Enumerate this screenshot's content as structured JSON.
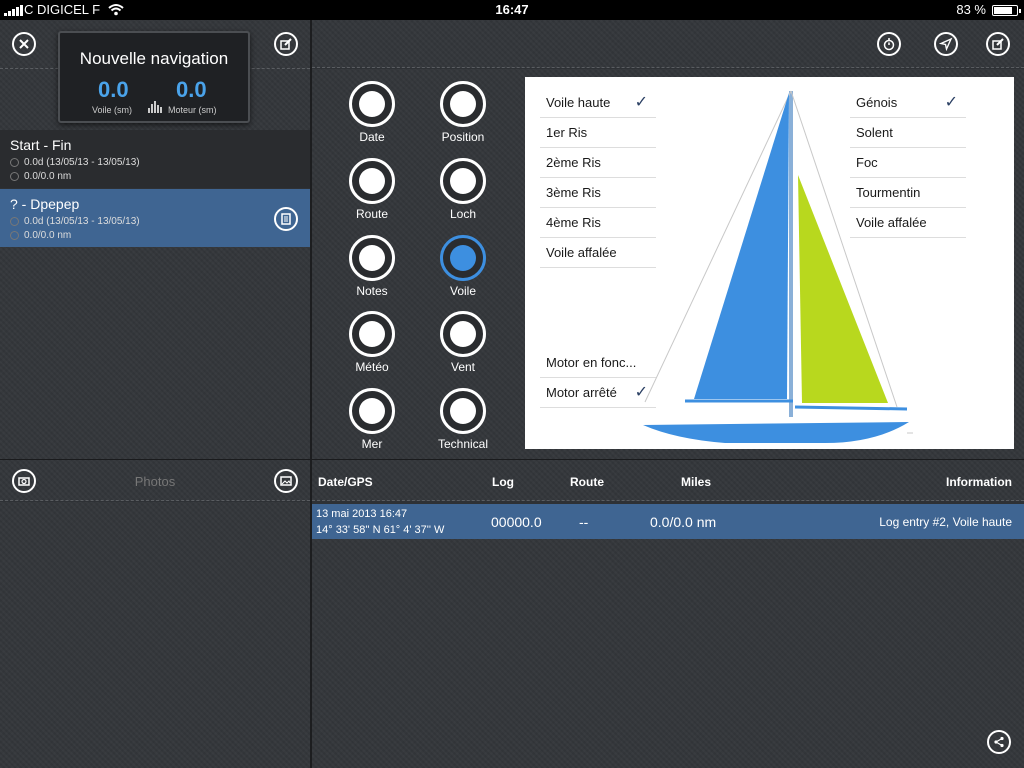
{
  "status": {
    "carrier": "C DIGICEL F",
    "time": "16:47",
    "battery": "83 %"
  },
  "nav": {
    "title": "Nouvelle navigation",
    "sail_value": "0.0",
    "motor_value": "0.0",
    "sail_label": "Voile (sm)",
    "motor_label": "Moteur (sm)"
  },
  "trips": [
    {
      "title": "Start - Fin",
      "line1": "0.0d (13/05/13 - 13/05/13)",
      "line2": "0.0/0.0 nm"
    },
    {
      "title": "? - Dpepep",
      "line1": "0.0d (13/05/13 - 13/05/13)",
      "line2": "0.0/0.0 nm"
    }
  ],
  "photos_label": "Photos",
  "categories": [
    {
      "label": "Date"
    },
    {
      "label": "Position"
    },
    {
      "label": "Route"
    },
    {
      "label": "Loch"
    },
    {
      "label": "Notes"
    },
    {
      "label": "Voile"
    },
    {
      "label": "Météo"
    },
    {
      "label": "Vent"
    },
    {
      "label": "Mer"
    },
    {
      "label": "Technical"
    }
  ],
  "mainsail_options": [
    {
      "label": "Voile haute",
      "checked": "✓"
    },
    {
      "label": "1er Ris",
      "checked": ""
    },
    {
      "label": "2ème Ris",
      "checked": ""
    },
    {
      "label": "3ème Ris",
      "checked": ""
    },
    {
      "label": "4ème Ris",
      "checked": ""
    },
    {
      "label": "Voile affalée",
      "checked": ""
    }
  ],
  "motor_options": [
    {
      "label": "Motor en fonc...",
      "checked": ""
    },
    {
      "label": "Motor arrêté",
      "checked": "✓"
    }
  ],
  "headsail_options": [
    {
      "label": "Génois",
      "checked": "✓"
    },
    {
      "label": "Solent",
      "checked": ""
    },
    {
      "label": "Foc",
      "checked": ""
    },
    {
      "label": "Tourmentin",
      "checked": ""
    },
    {
      "label": "Voile affalée",
      "checked": ""
    }
  ],
  "colors": {
    "mainsail": "#3d8fe0",
    "jib": "#b8d81e",
    "hull": "#3d8fe0",
    "selection": "#3f6592"
  },
  "log": {
    "headers": {
      "date": "Date/GPS",
      "log": "Log",
      "route": "Route",
      "miles": "Miles",
      "info": "Information"
    },
    "rows": [
      {
        "date": "13 mai 2013 16:47",
        "gps": "14° 33' 58'' N 61° 4' 37'' W",
        "log": "00000.0",
        "route": "--",
        "miles": "0.0/0.0 nm",
        "info": "Log entry #2, Voile haute"
      }
    ]
  },
  "icons": [
    "close-icon",
    "edit-icon",
    "stopwatch-icon",
    "location-arrow-icon",
    "compose-icon",
    "camera-icon",
    "photo-library-icon",
    "document-icon",
    "share-icon"
  ]
}
